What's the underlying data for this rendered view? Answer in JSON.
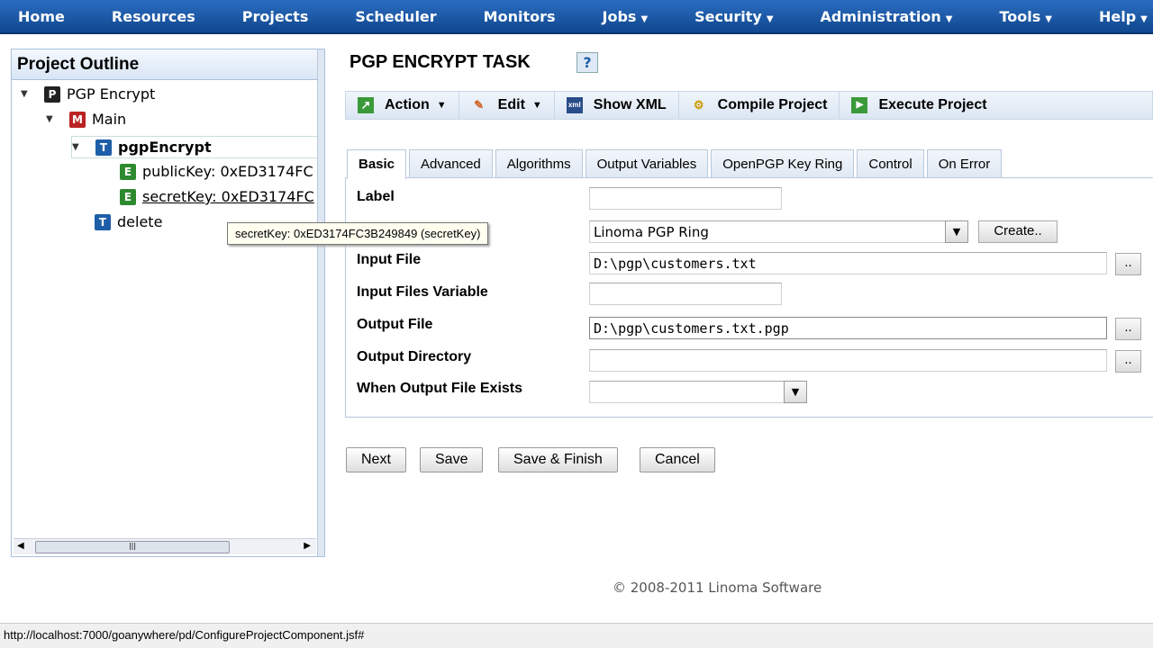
{
  "nav": [
    {
      "label": "Home"
    },
    {
      "label": "Resources"
    },
    {
      "label": "Projects"
    },
    {
      "label": "Scheduler"
    },
    {
      "label": "Monitors"
    },
    {
      "label": "Jobs",
      "dropdown": true
    },
    {
      "label": "Security",
      "dropdown": true
    },
    {
      "label": "Administration",
      "dropdown": true
    },
    {
      "label": "Tools",
      "dropdown": true
    },
    {
      "label": "Help",
      "dropdown": true
    }
  ],
  "outline": {
    "title": "Project Outline",
    "items": [
      "PGP Encrypt",
      "Main",
      "pgpEncrypt",
      "publicKey: 0xED3174FC",
      "secretKey: 0xED3174FC",
      "delete"
    ],
    "icons": [
      "P",
      "M",
      "T",
      "E",
      "E",
      "T"
    ]
  },
  "tooltip": "secretKey: 0xED3174FC3B249849 (secretKey)",
  "page": {
    "title": "PGP ENCRYPT TASK",
    "help": "?"
  },
  "toolbar": {
    "action": "Action",
    "edit": "Edit",
    "show_xml": "Show XML",
    "compile": "Compile Project",
    "execute": "Execute Project"
  },
  "tabs": [
    "Basic",
    "Advanced",
    "Algorithms",
    "Output Variables",
    "OpenPGP Key Ring",
    "Control",
    "On Error"
  ],
  "form": {
    "label": {
      "label": "Label",
      "value": ""
    },
    "keyring": {
      "value": "Linoma PGP Ring",
      "create": "Create.."
    },
    "input_file": {
      "label": "Input File",
      "value": "D:\\pgp\\customers.txt"
    },
    "input_files_var": {
      "label": "Input Files Variable",
      "value": ""
    },
    "output_file": {
      "label": "Output File",
      "value": "D:\\pgp\\customers.txt.pgp"
    },
    "output_dir": {
      "label": "Output Directory",
      "value": ""
    },
    "when_exists": {
      "label": "When Output File Exists",
      "value": ""
    },
    "browse": ".."
  },
  "buttons": {
    "next": "Next",
    "save": "Save",
    "save_finish": "Save & Finish",
    "cancel": "Cancel"
  },
  "footer": "© 2008-2011 Linoma Software",
  "status": "http://localhost:7000/goanywhere/pd/ConfigureProjectComponent.jsf#"
}
